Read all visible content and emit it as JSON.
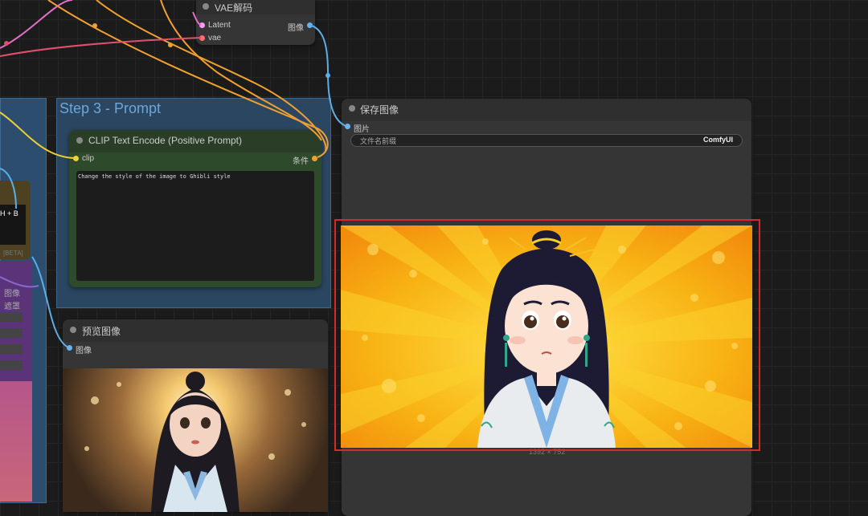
{
  "vae_decode": {
    "title": "VAE解码",
    "input_latent": "Latent",
    "input_vae": "vae",
    "output_image": "图像"
  },
  "group_step3": {
    "title": "Step 3 - Prompt"
  },
  "clip_node": {
    "title": "CLIP Text Encode (Positive Prompt)",
    "input_clip": "clip",
    "output_cond": "条件",
    "prompt_text": "Change the style of the image to Ghibli style"
  },
  "save_node": {
    "title": "保存图像",
    "input_image": "图片",
    "prefix_label": "文件名前缀",
    "prefix_value": "ComfyUI",
    "image_size": "1392 × 752"
  },
  "preview_node": {
    "title": "预览图像",
    "input_image": "图像"
  },
  "left_fragments": {
    "hotkey": "H + B",
    "beta": "[BETA]",
    "row1": "图像",
    "row2": "遮罩"
  },
  "colors": {
    "clip_node_bg": "#2d4a2b",
    "selection": "#d52a2a",
    "wire_orange": "#f0a030",
    "wire_pink": "#e070c8",
    "wire_blue": "#5aaee8",
    "wire_purple": "#8a68d0"
  }
}
